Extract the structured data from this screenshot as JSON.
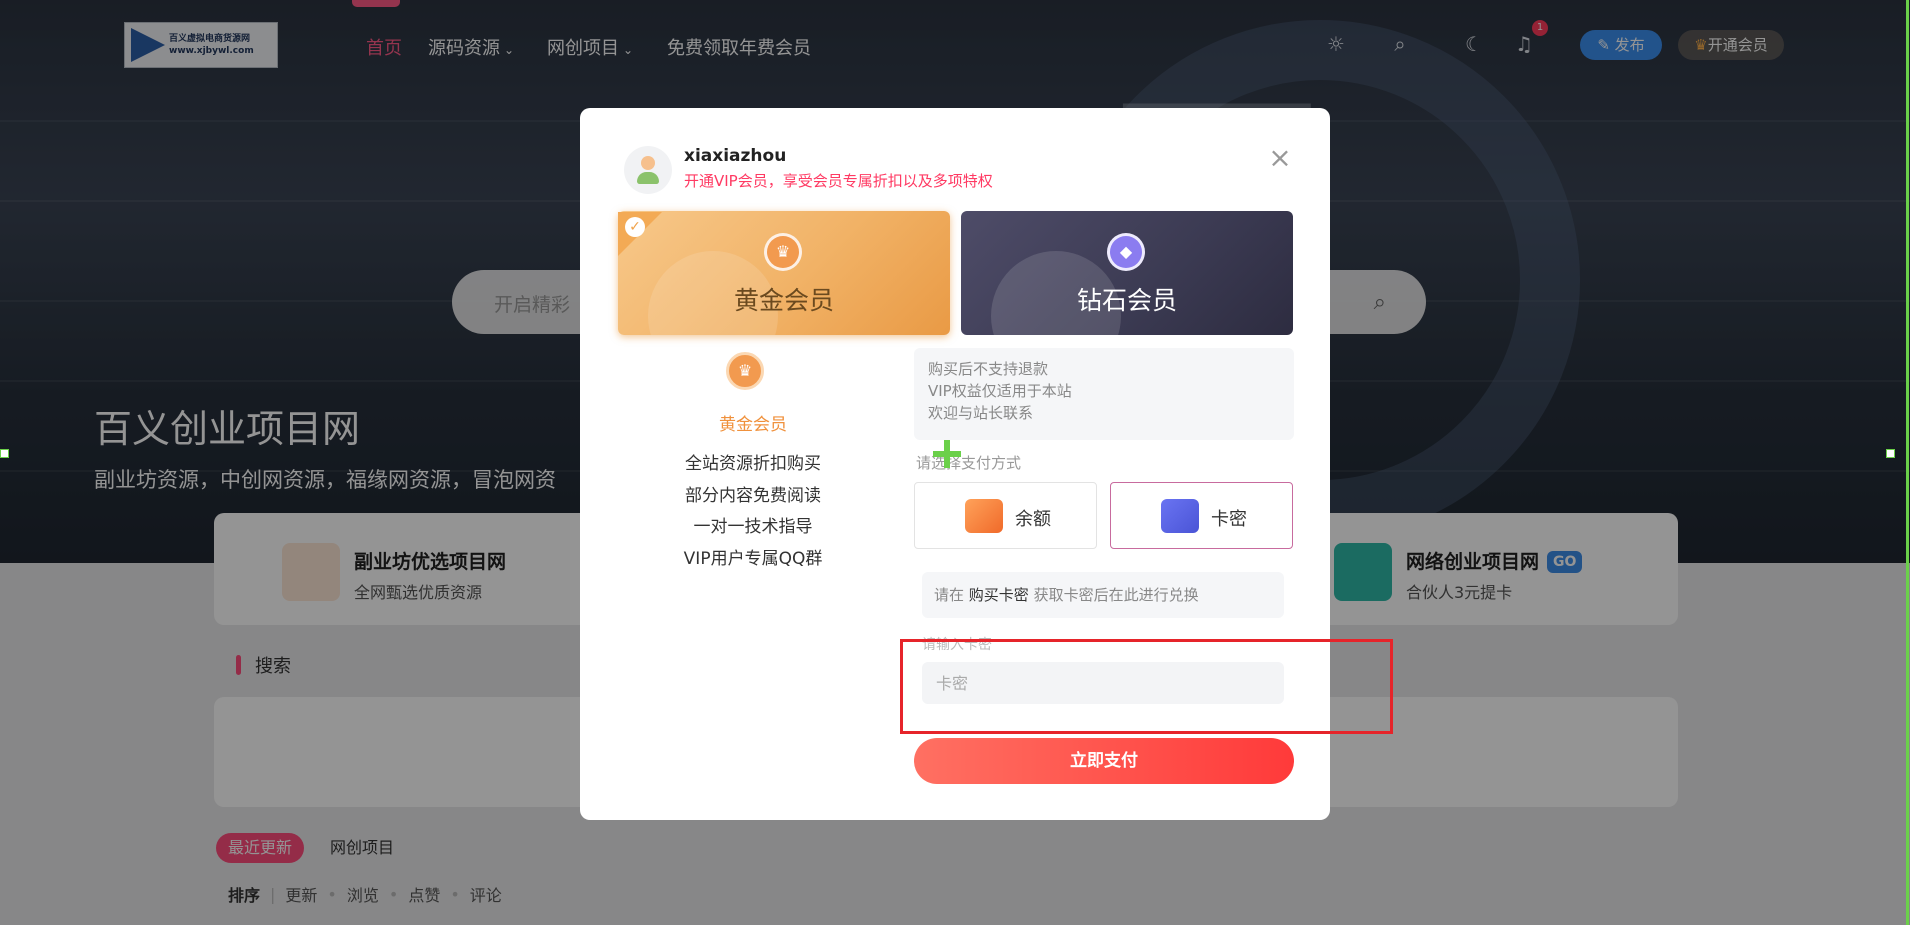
{
  "header": {
    "logo_text_line1": "百义虚拟电商货源网",
    "logo_text_line2": "www.xjbywl.com",
    "nav": [
      {
        "label": "首页"
      },
      {
        "label": "源码资源"
      },
      {
        "label": "网创项目"
      },
      {
        "label": "免费领取年费会员"
      }
    ],
    "notification_count": "1",
    "publish_label": "发布",
    "vip_label": "开通会员",
    "icons": [
      "bulb-icon",
      "search-icon",
      "moon-icon",
      "bell-icon"
    ]
  },
  "hero": {
    "search_placeholder": "开启精彩",
    "site_title": "百义创业项目网",
    "site_subtitle": "副业坊资源，中创网资源，福缘网资源，冒泡网资"
  },
  "feature_cards": [
    {
      "title": "副业坊优选项目网",
      "subtitle": "全网甄选优质资源",
      "icon": "crown-icon"
    },
    {
      "title": "网络创业项目网",
      "subtitle": "合伙人3元提卡",
      "go_label": "GO",
      "icon": "money-icon"
    }
  ],
  "search_section": {
    "title": "搜索"
  },
  "tabs": [
    {
      "label": "最近更新"
    },
    {
      "label": "网创项目"
    }
  ],
  "sort": {
    "label": "排序",
    "options": [
      "更新",
      "浏览",
      "点赞",
      "评论"
    ]
  },
  "modal": {
    "username": "xiaxiazhou",
    "tip": "开通VIP会员，享受会员专属折扣以及多项特权",
    "tiers": [
      {
        "name": "黄金会员",
        "selected": true
      },
      {
        "name": "钻石会员",
        "selected": false
      }
    ],
    "benefit_title": "黄金会员",
    "benefits": [
      "全站资源折扣购买",
      "部分内容免费阅读",
      "一对一技术指导",
      "VIP用户专属QQ群"
    ],
    "notice": [
      "购买后不支持退款",
      "VIP权益仅适用于本站",
      "欢迎与站长联系"
    ],
    "pay_method_label": "请选择支付方式",
    "pay_methods": [
      {
        "label": "余额",
        "icon": "wallet-icon"
      },
      {
        "label": "卡密",
        "icon": "card-icon",
        "selected": true
      }
    ],
    "redeem_tip_prefix": "请在",
    "redeem_tip_link": "购买卡密",
    "redeem_tip_suffix": "获取卡密后在此进行兑换",
    "card_input_label": "请输入卡密",
    "card_input_placeholder": "卡密",
    "pay_button": "立即支付"
  },
  "colors": {
    "accent": "#ff4d7d",
    "gold": "#f1b266",
    "pay_button": "#ff4a44",
    "highlight_box": "#e6242a"
  }
}
